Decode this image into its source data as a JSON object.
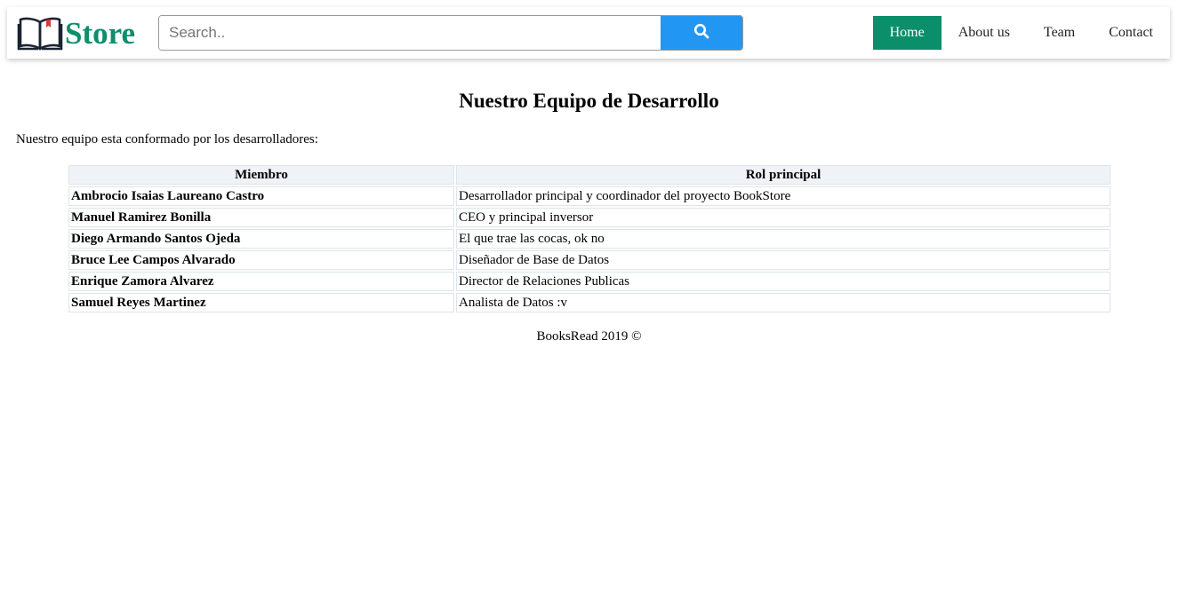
{
  "brand": {
    "name": "Store",
    "logo_icon": "open-book-icon"
  },
  "search": {
    "placeholder": "Search..",
    "button_icon": "search-icon"
  },
  "nav": {
    "items": [
      {
        "label": "Home",
        "active": true
      },
      {
        "label": "About us",
        "active": false
      },
      {
        "label": "Team",
        "active": false
      },
      {
        "label": "Contact",
        "active": false
      }
    ]
  },
  "main": {
    "title": "Nuestro Equipo de Desarrollo",
    "intro": "Nuestro equipo esta conformado por los desarrolladores:",
    "table": {
      "headers": [
        "Miembro",
        "Rol principal"
      ],
      "rows": [
        {
          "member": "Ambrocio Isaias Laureano Castro",
          "role": "Desarrollador principal y coordinador del proyecto BookStore"
        },
        {
          "member": "Manuel Ramirez Bonilla",
          "role": "CEO y principal inversor"
        },
        {
          "member": "Diego Armando Santos Ojeda",
          "role": "El que trae las cocas, ok no"
        },
        {
          "member": "Bruce Lee Campos Alvarado",
          "role": "Diseñador de Base de Datos"
        },
        {
          "member": "Enrique Zamora Alvarez",
          "role": "Director de Relaciones Publicas"
        },
        {
          "member": "Samuel Reyes Martinez",
          "role": "Analista de Datos :v"
        }
      ]
    }
  },
  "footer": {
    "text": "BooksRead 2019 ©"
  },
  "colors": {
    "brand": "#0e8e6c",
    "nav_active": "#0a8f6a",
    "search_button": "#2196f3",
    "table_header_bg": "#eff3f7",
    "table_border": "#dde5ec"
  }
}
